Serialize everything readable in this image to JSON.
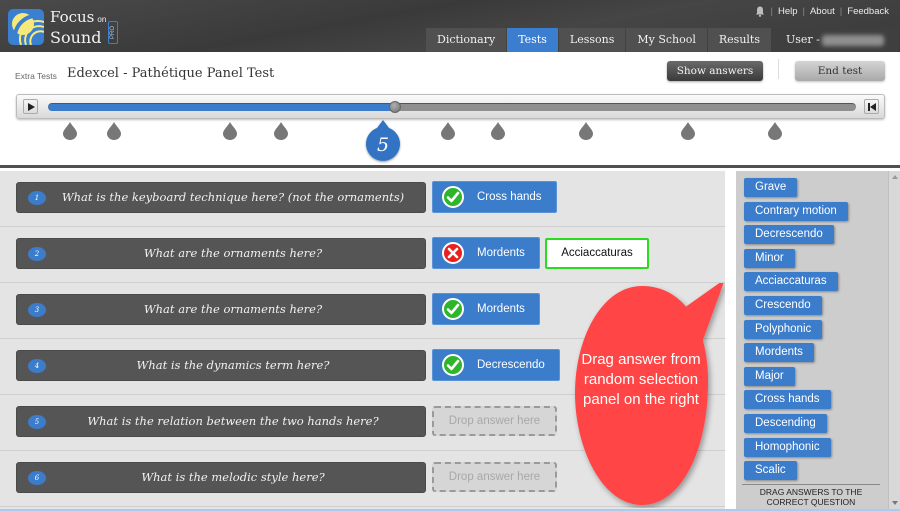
{
  "app": {
    "logo_line1": "Focus",
    "logo_on": "on",
    "logo_line2": "Sound",
    "logo_badge": "PRO"
  },
  "utility_links": {
    "bell_icon": "bell-icon",
    "help": "Help",
    "about": "About",
    "feedback": "Feedback",
    "separator": "|"
  },
  "nav": {
    "tabs": [
      {
        "label": "Dictionary",
        "active": false
      },
      {
        "label": "Tests",
        "active": true
      },
      {
        "label": "Lessons",
        "active": false
      },
      {
        "label": "My School",
        "active": false
      },
      {
        "label": "Results",
        "active": false
      }
    ],
    "user_label": "User -"
  },
  "test": {
    "breadcrumb": "Extra Tests",
    "title": "Edexcel - Pathétique Panel Test",
    "show_answers_label": "Show answers",
    "end_test_label": "End test"
  },
  "player": {
    "progress_fraction": 0.43,
    "current_marker": "5",
    "marker_count": 11,
    "current_marker_index": 4
  },
  "questions": [
    {
      "number": "1",
      "text": "What is the keyboard technique here? (not the ornaments)",
      "answer": "Cross hands",
      "status": "correct"
    },
    {
      "number": "2",
      "text": "What are the ornaments here?",
      "answer": "Mordents",
      "status": "incorrect",
      "correct_answer": "Acciaccaturas"
    },
    {
      "number": "3",
      "text": "What are the ornaments here?",
      "answer": "Mordents",
      "status": "correct"
    },
    {
      "number": "4",
      "text": "What is the dynamics term here?",
      "answer": "Decrescendo",
      "status": "correct"
    },
    {
      "number": "5",
      "text": "What is the relation between the two hands here?",
      "answer": null,
      "placeholder": "Drop answer here"
    },
    {
      "number": "6",
      "text": "What is the melodic style here?",
      "answer": null,
      "placeholder": "Drop answer here"
    }
  ],
  "callout": {
    "text": "Drag answer from random selection panel on the right",
    "color": "#ff4545"
  },
  "answer_panel": {
    "chips": [
      "Grave",
      "Contrary motion",
      "Decrescendo",
      "Minor",
      "Acciaccaturas",
      "Crescendo",
      "Polyphonic",
      "Mordents",
      "Major",
      "Cross hands",
      "Descending",
      "Homophonic",
      "Scalic"
    ],
    "footer": "DRAG ANSWERS TO THE CORRECT QUESTION"
  },
  "colors": {
    "accent_blue": "#3b7ccb",
    "correct_green": "#2bdc1e",
    "incorrect_red": "#e8201e",
    "header_dark": "#3f3f3f"
  }
}
